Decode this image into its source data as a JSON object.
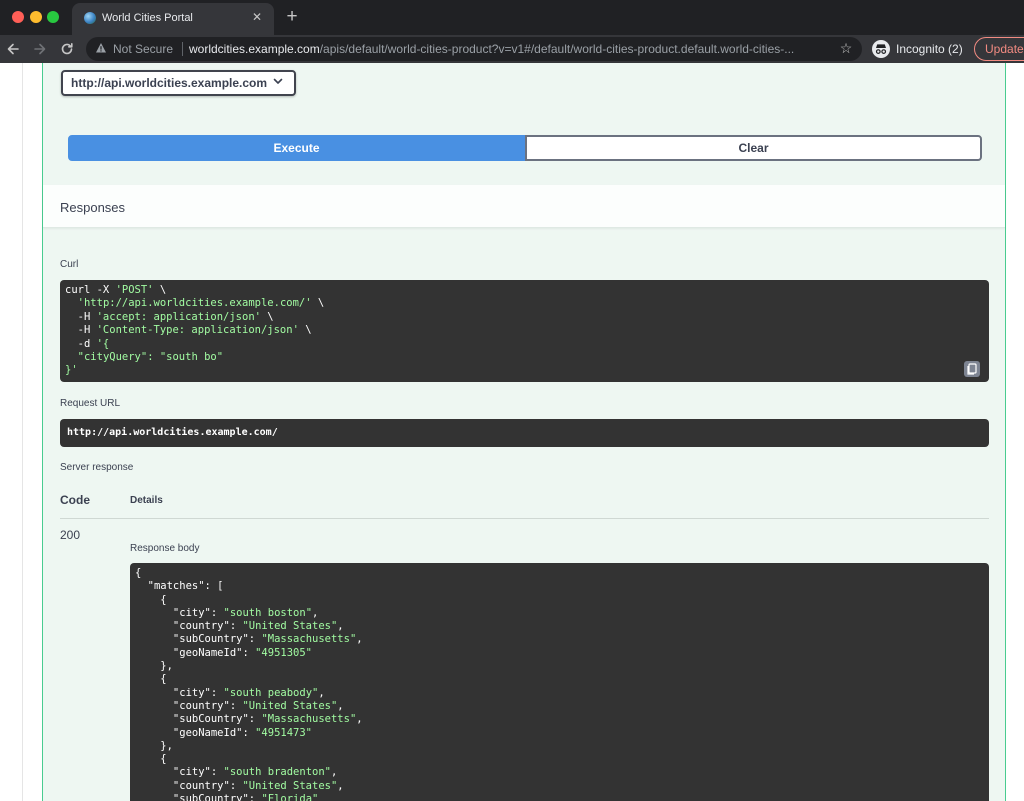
{
  "browser": {
    "tab_title": "World Cities Portal",
    "tab_close": "✕",
    "new_tab": "+",
    "security_label": "Not Secure",
    "url_host": "worldcities.example.com",
    "url_path": "/apis/default/world-cities-product?v=v1#/default/world-cities-product.default.world-cities-...",
    "incognito_label": "Incognito (2)",
    "update_label": "Update"
  },
  "server": {
    "selected": "http://api.worldcities.example.com"
  },
  "actions": {
    "execute_label": "Execute",
    "clear_label": "Clear"
  },
  "responses": {
    "title": "Responses",
    "curl_label": "Curl",
    "curl_lines": [
      [
        "curl -X ",
        "'POST'",
        " \\"
      ],
      [
        "  ",
        "'http://api.worldcities.example.com/'",
        " \\"
      ],
      [
        "  -H ",
        "'accept: application/json'",
        " \\"
      ],
      [
        "  -H ",
        "'Content-Type: application/json'",
        " \\"
      ],
      [
        "  -d ",
        "'{",
        ""
      ],
      [
        "  ",
        "\"cityQuery\": \"south bo\"",
        ""
      ],
      [
        "",
        "}'",
        ""
      ]
    ],
    "request_url_label": "Request URL",
    "request_url": "http://api.worldcities.example.com/",
    "server_response_label": "Server response",
    "col_code": "Code",
    "col_details": "Details",
    "status_code": "200",
    "response_body_label": "Response body",
    "response_body_matches": [
      {
        "city": "south boston",
        "country": "United States",
        "subCountry": "Massachusetts",
        "geoNameId": "4951305"
      },
      {
        "city": "south peabody",
        "country": "United States",
        "subCountry": "Massachusetts",
        "geoNameId": "4951473"
      },
      {
        "city": "south bradenton",
        "country": "United States",
        "subCountry": "Florida"
      }
    ]
  },
  "colors": {
    "accent_execute": "#4990e2",
    "operation_bg": "#eef7f2",
    "operation_border": "#49cc90",
    "code_bg": "#333333",
    "string_green": "#a2fca2"
  }
}
